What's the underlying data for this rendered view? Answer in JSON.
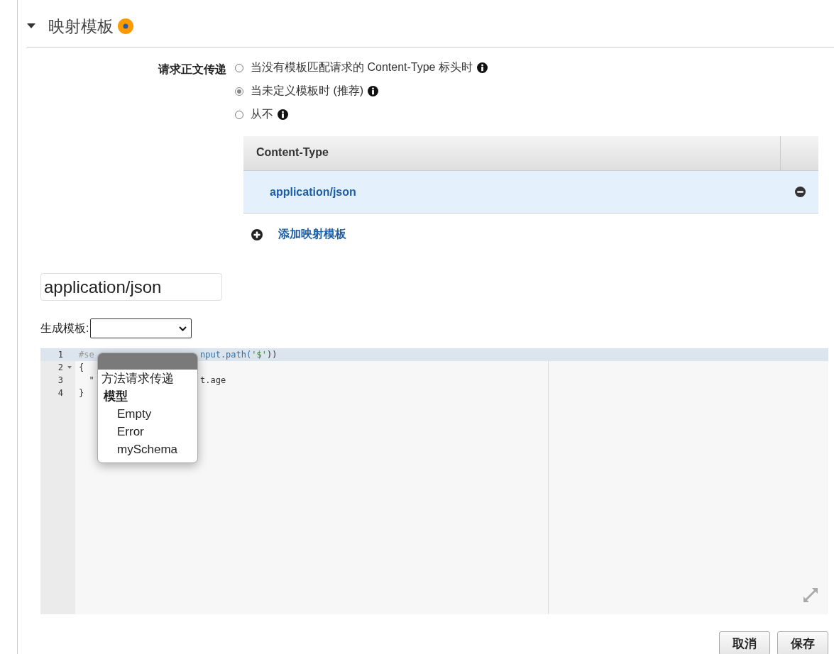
{
  "section": {
    "title": "映射模板",
    "expanded": true
  },
  "passthrough": {
    "label": "请求正文传递",
    "options": [
      {
        "label": "当没有模板匹配请求的 Content-Type 标头时",
        "selected": false
      },
      {
        "label": "当未定义模板时 (推荐)",
        "selected": true
      },
      {
        "label": "从不",
        "selected": false
      }
    ]
  },
  "content_types": {
    "column": "Content-Type",
    "rows": [
      {
        "value": "application/json",
        "selected": true
      }
    ],
    "add_label": "添加映射模板"
  },
  "type_field": {
    "value": "application/json"
  },
  "generate": {
    "label": "生成模板:",
    "items": [
      {
        "kind": "blank",
        "selected": true
      },
      {
        "kind": "option",
        "label": "方法请求传递",
        "selected": false
      },
      {
        "kind": "group",
        "label": "模型"
      },
      {
        "kind": "option",
        "label": "Empty",
        "selected": false
      },
      {
        "kind": "option",
        "label": "Error",
        "selected": false
      },
      {
        "kind": "option",
        "label": "mySchema",
        "selected": false
      }
    ]
  },
  "editor": {
    "lines": [
      {
        "number": "1",
        "active": true,
        "foldable": false,
        "left": [
          {
            "kind": "directive",
            "text": "#se"
          }
        ],
        "right": [
          {
            "kind": "variable",
            "text": "nput.path("
          },
          {
            "kind": "string",
            "text": "'$'"
          },
          {
            "kind": "plain",
            "text": "))"
          }
        ]
      },
      {
        "number": "2",
        "active": false,
        "foldable": true,
        "left": [
          {
            "kind": "plain",
            "text": "{"
          }
        ]
      },
      {
        "number": "3",
        "active": false,
        "foldable": false,
        "left": [
          {
            "kind": "plain",
            "text": "  \""
          }
        ],
        "right": [
          {
            "kind": "plain",
            "text": "t.age"
          }
        ]
      },
      {
        "number": "4",
        "active": false,
        "foldable": false,
        "left": [
          {
            "kind": "plain",
            "text": "}"
          }
        ]
      }
    ]
  },
  "buttons": [
    {
      "label": "取消"
    },
    {
      "label": "保存"
    }
  ]
}
